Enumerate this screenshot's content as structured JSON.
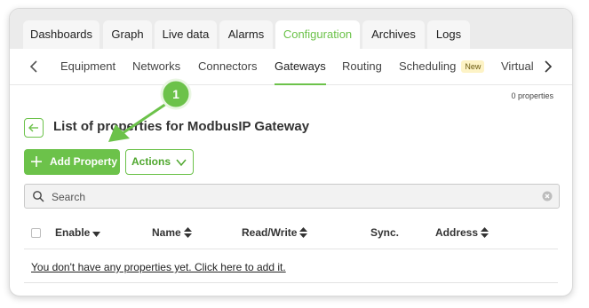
{
  "top_tabs": [
    {
      "label": "Dashboards",
      "active": false
    },
    {
      "label": "Graph",
      "active": false
    },
    {
      "label": "Live data",
      "active": false
    },
    {
      "label": "Alarms",
      "active": false
    },
    {
      "label": "Configuration",
      "active": true
    },
    {
      "label": "Archives",
      "active": false
    },
    {
      "label": "Logs",
      "active": false
    }
  ],
  "sub_nav": {
    "items": [
      {
        "label": "Equipment",
        "active": false
      },
      {
        "label": "Networks",
        "active": false
      },
      {
        "label": "Connectors",
        "active": false
      },
      {
        "label": "Gateways",
        "active": true
      },
      {
        "label": "Routing",
        "active": false
      },
      {
        "label": "Scheduling",
        "active": false,
        "badge": "New"
      },
      {
        "label": "Virtual",
        "active": false
      }
    ]
  },
  "property_count": "0 properties",
  "page_title": "List of properties for ModbusIP Gateway",
  "toolbar": {
    "add_label": "Add Property",
    "actions_label": "Actions"
  },
  "search": {
    "placeholder": "Search",
    "value": ""
  },
  "table": {
    "columns": [
      "Enable",
      "Name",
      "Read/Write",
      "Sync.",
      "Address"
    ],
    "rows": []
  },
  "empty_message": "You don't have any properties yet. Click here to add it.",
  "callout": {
    "number": "1"
  },
  "icons": {
    "prev": "chevron-left-icon",
    "next": "chevron-right-icon",
    "back": "arrow-left-icon",
    "add": "plus-icon",
    "actions": "chevron-down-icon",
    "search": "search-icon",
    "clear": "clear-icon",
    "sort": "sort-icon",
    "filter": "caret-down-icon"
  },
  "colors": {
    "accent": "#6cc24a",
    "badge_bg": "#fdf3c6",
    "tabbar_bg": "#ebebeb"
  }
}
